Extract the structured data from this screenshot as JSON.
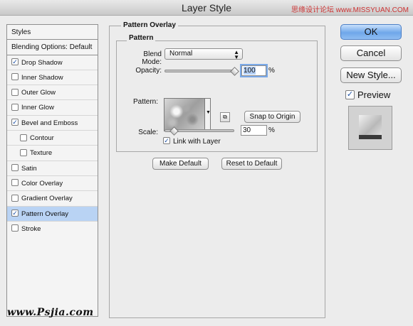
{
  "window": {
    "title": "Layer Style",
    "watermark": "思缘设计论坛 www.MISSYUAN.COM"
  },
  "styles_list": {
    "header_styles": "Styles",
    "header_blending": "Blending Options: Default",
    "items": [
      {
        "label": "Drop Shadow",
        "checked": true
      },
      {
        "label": "Inner Shadow",
        "checked": false
      },
      {
        "label": "Outer Glow",
        "checked": false
      },
      {
        "label": "Inner Glow",
        "checked": false
      },
      {
        "label": "Bevel and Emboss",
        "checked": true
      },
      {
        "label": "Contour",
        "checked": false
      },
      {
        "label": "Texture",
        "checked": false
      },
      {
        "label": "Satin",
        "checked": false
      },
      {
        "label": "Color Overlay",
        "checked": false
      },
      {
        "label": "Gradient Overlay",
        "checked": false
      },
      {
        "label": "Pattern Overlay",
        "checked": true
      },
      {
        "label": "Stroke",
        "checked": false
      }
    ]
  },
  "pattern_overlay": {
    "section_title": "Pattern Overlay",
    "group_title": "Pattern",
    "blend_mode_label": "Blend Mode:",
    "blend_mode_value": "Normal",
    "opacity_label": "Opacity:",
    "opacity_value": "100",
    "opacity_unit": "%",
    "opacity_level": 1.0,
    "pattern_label": "Pattern:",
    "snap_button": "Snap to Origin",
    "scale_label": "Scale:",
    "scale_value": "30",
    "scale_unit": "%",
    "scale_level": 0.03,
    "link_label": "Link with Layer",
    "link_checked": true,
    "make_default": "Make Default",
    "reset_default": "Reset to Default"
  },
  "actions": {
    "ok": "OK",
    "cancel": "Cancel",
    "new_style": "New Style...",
    "preview_label": "Preview",
    "preview_checked": true
  },
  "footer": {
    "site": "www.Psjia.com"
  },
  "colors": {
    "selection": "#b9d3f4",
    "default_button": "#6fa7ea",
    "check": "#1b4fa4"
  }
}
